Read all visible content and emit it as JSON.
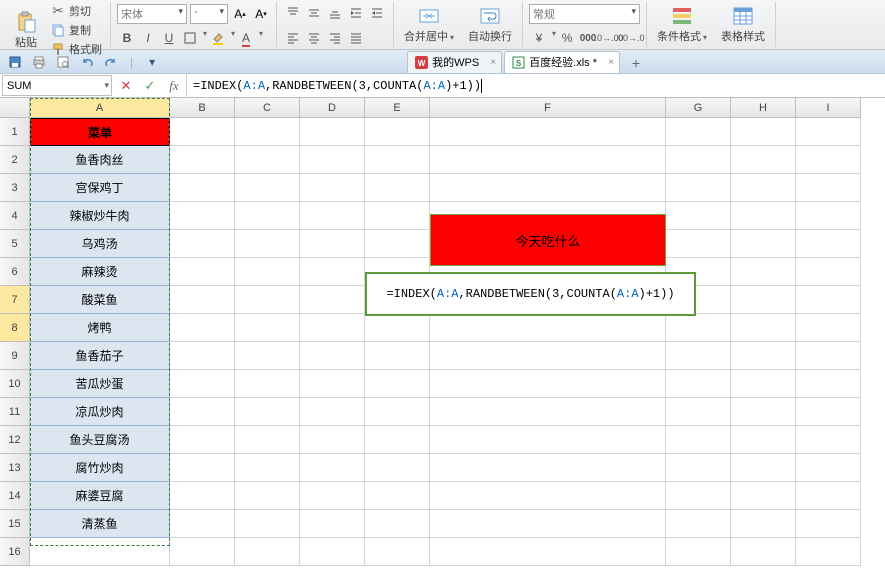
{
  "ribbon": {
    "paste_label": "粘贴",
    "cut_label": "剪切",
    "copy_label": "复制",
    "format_painter_label": "格式刷",
    "font_family": "宋体",
    "font_size": "-",
    "merge_center_label": "合并居中",
    "wrap_text_label": "自动换行",
    "number_format": "常规",
    "conditional_format_label": "条件格式",
    "table_style_label": "表格样式"
  },
  "tabs": {
    "wps_tab": "我的WPS",
    "file_tab": "百度经验.xls *"
  },
  "formula_bar": {
    "name_box": "SUM",
    "formula_prefix": "=INDEX(",
    "ref1": "A:A",
    "mid1": ",RANDBETWEEN(3,COUNTA(",
    "ref2": "A:A",
    "suffix": ")+1))"
  },
  "columns": [
    "A",
    "B",
    "C",
    "D",
    "E",
    "F",
    "G",
    "H",
    "I"
  ],
  "rows": [
    "1",
    "2",
    "3",
    "4",
    "5",
    "6",
    "7",
    "8",
    "9",
    "10",
    "11",
    "12",
    "13",
    "14",
    "15",
    "16"
  ],
  "menu": {
    "header": "菜单",
    "items": [
      "鱼香肉丝",
      "宫保鸡丁",
      "辣椒炒牛肉",
      "乌鸡汤",
      "麻辣烫",
      "酸菜鱼",
      "烤鸭",
      "鱼香茄子",
      "苦瓜炒蛋",
      "凉瓜炒肉",
      "鱼头豆腐汤",
      "腐竹炒肉",
      "麻婆豆腐",
      "清蒸鱼"
    ]
  },
  "banner": {
    "text": "今天吃什么"
  },
  "cell_formula": {
    "prefix": "=INDEX(",
    "ref1": "A:A",
    "mid1": ",RANDBETWEEN(3,COUNTA(",
    "ref2": "A:A",
    "suffix": ")+1))"
  },
  "chart_data": {
    "type": "table",
    "title": "菜单",
    "categories": [
      "鱼香肉丝",
      "宫保鸡丁",
      "辣椒炒牛肉",
      "乌鸡汤",
      "麻辣烫",
      "酸菜鱼",
      "烤鸭",
      "鱼香茄子",
      "苦瓜炒蛋",
      "凉瓜炒肉",
      "鱼头豆腐汤",
      "腐竹炒肉",
      "麻婆豆腐",
      "清蒸鱼"
    ],
    "values": []
  }
}
